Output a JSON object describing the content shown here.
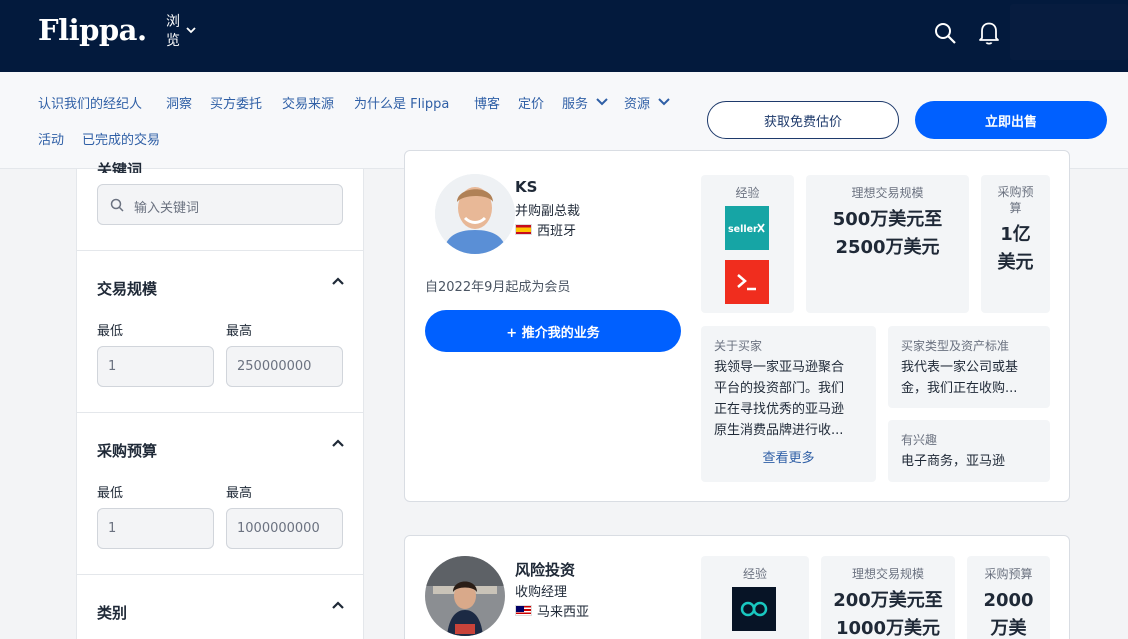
{
  "header": {
    "logo": "Flippa.",
    "browse": "浏览"
  },
  "subnav": {
    "links": [
      "认识我们的经纪人",
      "洞察",
      "买方委托",
      "交易来源",
      "为什么是 Flippa",
      "博客",
      "定价",
      "服务",
      "资源",
      "活动",
      "已完成的交易"
    ],
    "cta_secondary": "获取免费估价",
    "cta_primary": "立即出售"
  },
  "sidebar": {
    "keyword_label": "关键词",
    "keyword_placeholder": "输入关键词",
    "deal_size": {
      "title": "交易规模",
      "min_label": "最低",
      "max_label": "最高",
      "min_value": "1",
      "max_value": "250000000"
    },
    "budget": {
      "title": "采购预算",
      "min_label": "最低",
      "max_label": "最高",
      "min_value": "1",
      "max_value": "1000000000"
    },
    "category": {
      "title": "类别"
    }
  },
  "buyers": [
    {
      "name": "KS",
      "role": "并购副总裁",
      "country": "西班牙",
      "member_since": "自2022年9月起成为会员",
      "refer_button": "+ 推介我的业务",
      "experience_label": "经验",
      "experience_logos": [
        "sellerX-logo",
        "terminal-logo"
      ],
      "ideal_deal_label": "理想交易规模",
      "ideal_deal_value_line1": "500万美元至",
      "ideal_deal_value_line2": "2500万美元",
      "budget_label_line1": "采购预",
      "budget_label_line2": "算",
      "budget_value_line1": "1亿",
      "budget_value_line2": "美元",
      "about_label": "关于买家",
      "about_lines": [
        "我领导一家亚马逊聚合",
        "平台的投资部门。我们",
        "正在寻找优秀的亚马逊",
        "原生消费品牌进行收..."
      ],
      "see_more": "查看更多",
      "buyer_type_label": "买家类型及资产标准",
      "buyer_type_lines": [
        "我代表一家公司或基",
        "金，我们正在收购..."
      ],
      "interest_label": "有兴趣",
      "interest_value": "电子商务，亚马逊"
    },
    {
      "name": "风险投资",
      "role": "收购经理",
      "country": "马来西亚",
      "experience_label": "经验",
      "ideal_deal_label": "理想交易规模",
      "ideal_deal_value_line1": "200万美元至",
      "ideal_deal_value_line2": "1000万美元",
      "budget_label": "采购预算",
      "budget_value_line1": "2000",
      "budget_value_line2": "万美"
    }
  ]
}
